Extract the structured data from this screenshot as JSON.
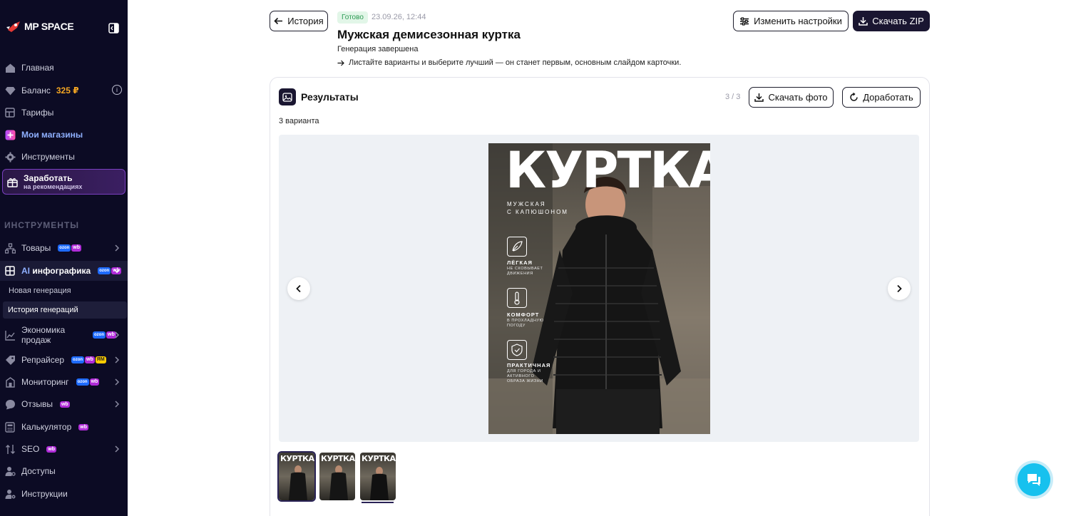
{
  "sidebar": {
    "logo": "MP SPACE",
    "items": [
      {
        "label": "Главная",
        "icon": "home-icon"
      },
      {
        "label": "Баланс",
        "value": "325 ₽",
        "icon": "diamond-icon"
      },
      {
        "label": "Тарифы",
        "icon": "grid-icon"
      },
      {
        "label": "Мои магазины",
        "icon": "plus-square-icon"
      },
      {
        "label": "Инструменты",
        "icon": "gear-icon"
      }
    ],
    "earn": {
      "title": "Заработать",
      "subtitle": "на рекомендациях",
      "icon": "gift-icon"
    },
    "section_title": "ИНСТРУМЕНТЫ",
    "tools": [
      {
        "label": "Товары",
        "badges": [
          "ozon",
          "wb"
        ]
      },
      {
        "label_ai": "AI",
        "label": "инфографика",
        "badges": [
          "ozon",
          "wb"
        ]
      },
      {
        "label": "Экономика продаж",
        "badges": [
          "ozon",
          "wb"
        ]
      },
      {
        "label": "Репрайсер",
        "badges": [
          "ozon",
          "wb",
          "ym"
        ]
      },
      {
        "label": "Мониторинг",
        "badges": [
          "ozon",
          "wb"
        ]
      },
      {
        "label": "Отзывы",
        "badges": [
          "wb"
        ]
      },
      {
        "label": "Калькулятор",
        "badges": [
          "wb"
        ]
      },
      {
        "label": "SEO",
        "badges": [
          "wb"
        ]
      },
      {
        "label": "Доступы",
        "badges": []
      },
      {
        "label": "Инструкции",
        "badges": []
      }
    ],
    "subitems": [
      {
        "label": "Новая генерация"
      },
      {
        "label": "История генераций"
      }
    ],
    "badge_labels": {
      "ozon": "ozon",
      "wb": "wb",
      "ym": "ЯМ"
    }
  },
  "header": {
    "back_label": "История",
    "status": "Готово",
    "date": "23.09.26, 12:44",
    "title": "Мужская демисезонная куртка",
    "subtitle": "Генерация завершена",
    "hint": "Листайте варианты и выберите лучший — он станет первым, основным слайдом карточки.",
    "settings_label": "Изменить настройки",
    "zip_label": "Скачать ZIP"
  },
  "results": {
    "title": "Результаты",
    "counter": "3 / 3",
    "download_label": "Скачать фото",
    "refine_label": "Доработать",
    "variants_label": "3 варианта",
    "selected_index": 1
  },
  "poster": {
    "title": "КУРТКА",
    "subtitle_line1": "МУЖСКАЯ",
    "subtitle_line2": "С КАПЮШОНОМ",
    "features": [
      {
        "title": "ЛЁГКАЯ",
        "desc": "НЕ СКОВЫВАЕТ ДВИЖЕНИЯ",
        "icon": "feather-icon"
      },
      {
        "title": "КОМФОРТ",
        "desc": "В ПРОХЛАДНУЮ ПОГОДУ",
        "icon": "thermometer-icon"
      },
      {
        "title": "ПРАКТИЧНАЯ",
        "desc": "ДЛЯ ГОРОДА И АКТИВНОГО ОБРАЗА ЖИЗНИ",
        "icon": "shield-icon"
      }
    ]
  },
  "thumbnails": [
    {
      "label": "КУРТКА"
    },
    {
      "label": "КУРТКА"
    },
    {
      "label": "КУРТКА"
    }
  ],
  "colors": {
    "sidebar_bg": "#0c0b24",
    "accent_dark": "#1a1631",
    "status_green": "#2b9a52",
    "chat_blue": "#17c1ee",
    "balance_orange": "#f4a623"
  }
}
